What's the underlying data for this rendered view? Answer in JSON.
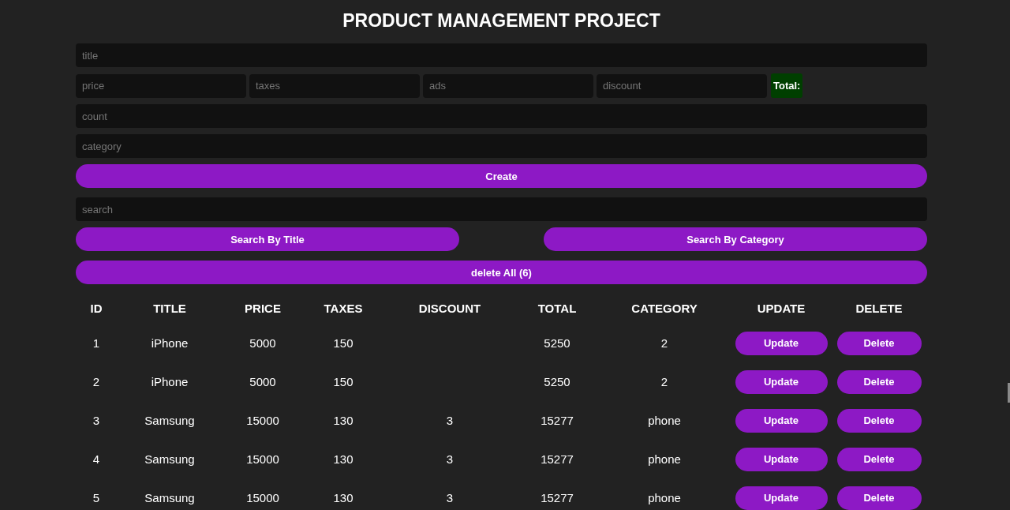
{
  "heading": "PRODUCT MANAGEMENT PROJECT",
  "form": {
    "title": {
      "placeholder": "title"
    },
    "price_fields": [
      {
        "placeholder": "price"
      },
      {
        "placeholder": "taxes"
      },
      {
        "placeholder": "ads"
      },
      {
        "placeholder": "discount"
      }
    ],
    "total": {
      "label": "Total:"
    },
    "count": {
      "placeholder": "count"
    },
    "category": {
      "placeholder": "category"
    },
    "create_button": "Create"
  },
  "search": {
    "placeholder": "search",
    "buttons": [
      "Search By Title",
      "Search By Category"
    ]
  },
  "delete_all_button": "delete All (6)",
  "table": {
    "columns": [
      "ID",
      "TITLE",
      "PRICE",
      "TAXES",
      "DISCOUNT",
      "TOTAL",
      "CATEGORY",
      "UPDATE",
      "DELETE"
    ],
    "rows": [
      {
        "id": "1",
        "title": "iPhone",
        "price": "5000",
        "taxes": "150",
        "total": "5250",
        "category": "2",
        "update": "Update",
        "delete": "Delete"
      },
      {
        "id": "2",
        "title": "iPhone",
        "price": "5000",
        "taxes": "150",
        "total": "5250",
        "category": "2",
        "update": "Update",
        "delete": "Delete"
      },
      {
        "id": "3",
        "title": "Samsung",
        "price": "15000",
        "taxes": "130",
        "discount": "3",
        "total": "15277",
        "category": "phone",
        "update": "Update",
        "delete": "Delete"
      },
      {
        "id": "4",
        "title": "Samsung",
        "price": "15000",
        "taxes": "130",
        "discount": "3",
        "total": "15277",
        "category": "phone",
        "update": "Update",
        "delete": "Delete"
      },
      {
        "id": "5",
        "title": "Samsung",
        "price": "15000",
        "taxes": "130",
        "discount": "3",
        "total": "15277",
        "category": "phone",
        "update": "Update",
        "delete": "Delete"
      }
    ]
  }
}
